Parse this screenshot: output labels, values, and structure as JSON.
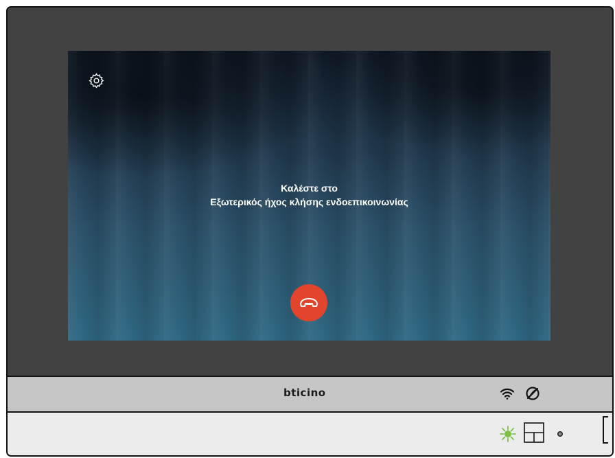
{
  "screen": {
    "message_line1": "Καλέστε στο",
    "message_line2": "Εξωτερικός ήχος κλήσης ενδοεπικοινωνίας",
    "settings_icon": "gear-icon",
    "hangup_icon": "phone-hangup-icon"
  },
  "device_bar": {
    "brand": "bticino",
    "wifi_icon": "wifi-icon",
    "do_not_disturb_icon": "do-not-disturb-icon"
  },
  "controls": {
    "led_icon": "led-indicator-icon",
    "home_icon": "home-button-icon",
    "led_color": "#7cc242"
  },
  "colors": {
    "hangup": "#e2452b",
    "frame": "#424242",
    "bar": "#c6c6c6"
  }
}
